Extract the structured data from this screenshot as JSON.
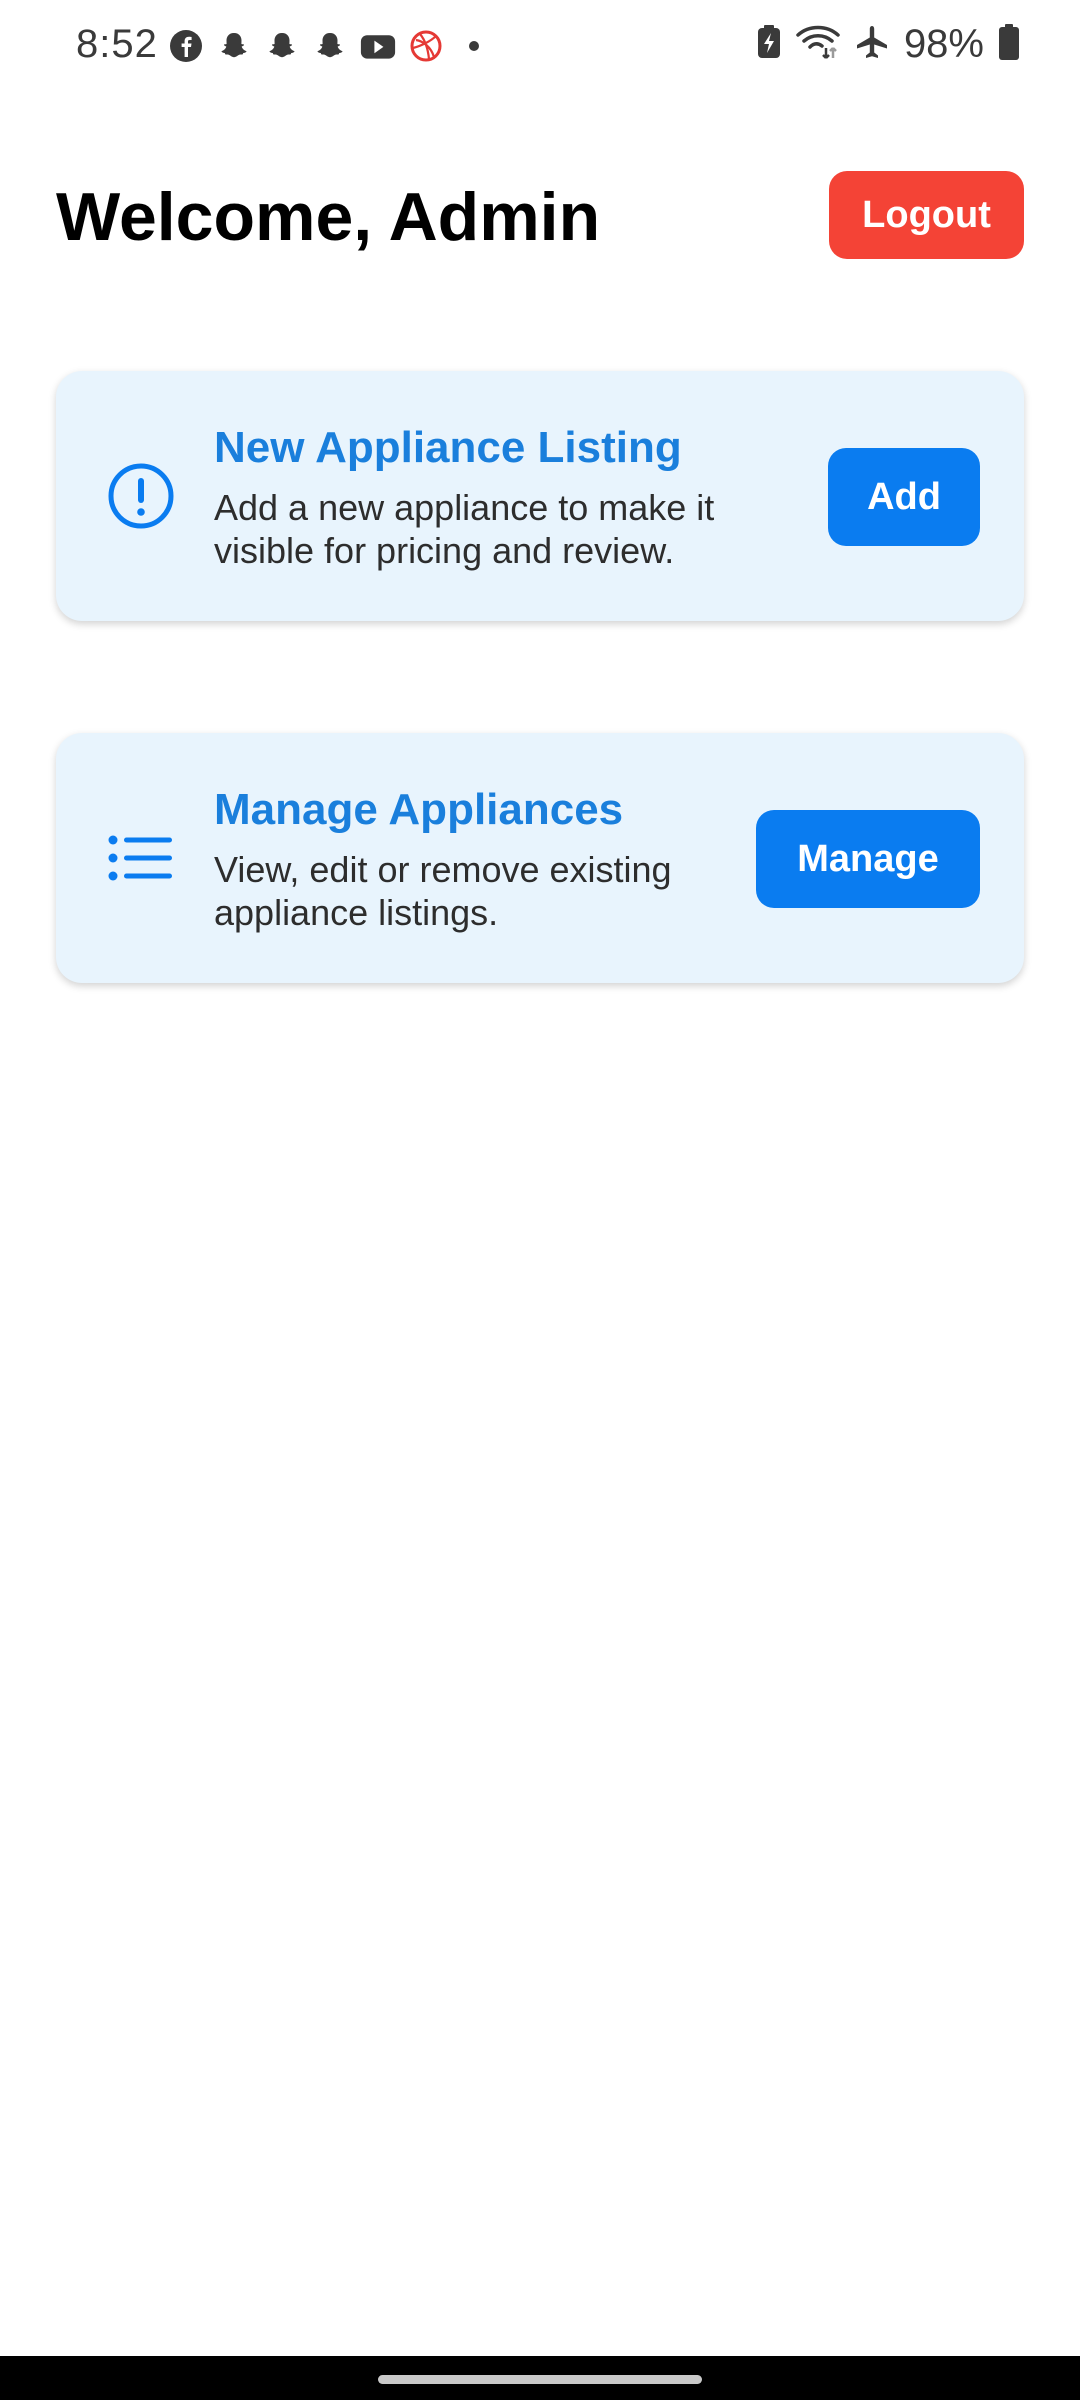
{
  "status_bar": {
    "time": "8:52",
    "battery_percent": "98%",
    "left_icons": [
      "facebook-icon",
      "snapchat-icon",
      "snapchat-icon",
      "snapchat-icon",
      "youtube-icon",
      "dribbble-icon",
      "dot-icon"
    ],
    "right_icons": [
      "battery-saver-icon",
      "wifi-icon",
      "airplane-icon",
      "battery-icon"
    ]
  },
  "header": {
    "title": "Welcome, Admin",
    "logout_label": "Logout"
  },
  "cards": [
    {
      "title": "New Appliance Listing",
      "description": "Add a new appliance to make it visible for pricing and review.",
      "button_label": "Add",
      "icon": "alert-circle-icon"
    },
    {
      "title": "Manage Appliances",
      "description": "View, edit or remove existing appliance listings.",
      "button_label": "Manage",
      "icon": "list-icon"
    }
  ],
  "colors": {
    "accent": "#0a7cf0",
    "title_blue": "#1a7fdc",
    "logout_red": "#f44336",
    "card_bg": "#e8f4fd"
  }
}
